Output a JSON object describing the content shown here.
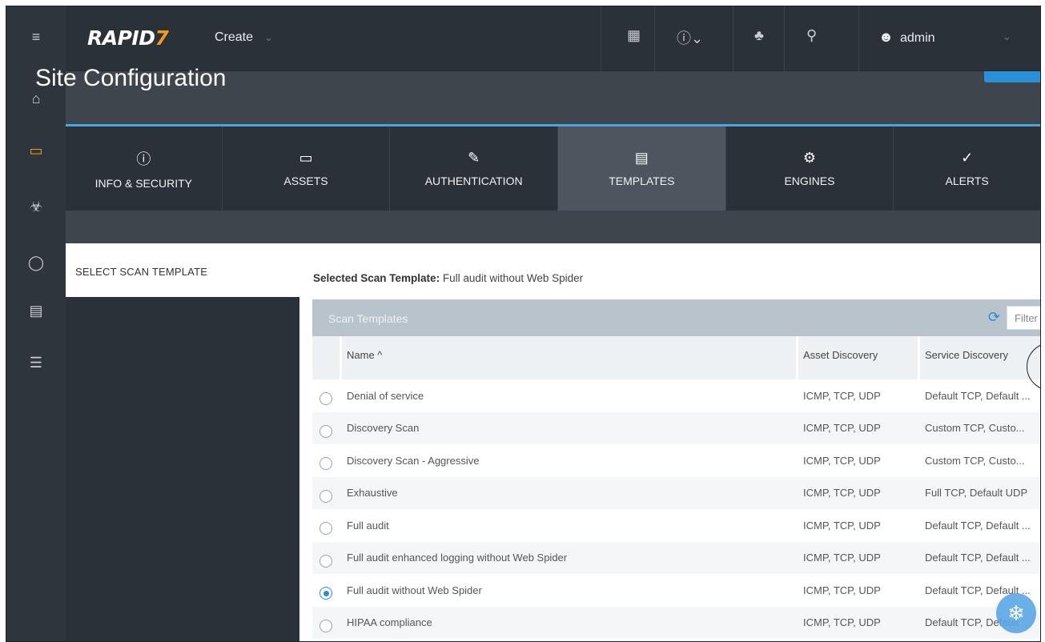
{
  "app": {
    "brand": "RAPID",
    "brand_mark": "7",
    "create_label": "Create"
  },
  "topbar": {
    "icons": [
      "calendar-icon",
      "help-icon",
      "bell-icon",
      "search-icon",
      "user-icon"
    ],
    "user_name": "admin"
  },
  "page": {
    "title": "Site Configuration"
  },
  "tabs": [
    {
      "label": "INFO & SECURITY",
      "icon": "info-icon",
      "active": false
    },
    {
      "label": "ASSETS",
      "icon": "monitor-icon",
      "active": false
    },
    {
      "label": "AUTHENTICATION",
      "icon": "credential-icon",
      "active": false
    },
    {
      "label": "TEMPLATES",
      "icon": "template-icon",
      "active": true
    },
    {
      "label": "ENGINES",
      "icon": "engine-gears-icon",
      "active": false
    },
    {
      "label": "ALERTS",
      "icon": "shield-check-icon",
      "active": false
    }
  ],
  "side_panel": {
    "label": "SELECT SCAN TEMPLATE"
  },
  "selected_template": {
    "prefix": "Selected Scan Template:",
    "value": "Full audit without Web Spider"
  },
  "grid": {
    "title": "Scan Templates",
    "filter_placeholder": "Filter",
    "columns": {
      "name": "Name ^",
      "asset": "Asset Discovery",
      "service": "Service Discovery"
    },
    "rows": [
      {
        "name": "Denial of service",
        "asset": "ICMP, TCP, UDP",
        "service": "Default TCP, Default ...",
        "selected": false
      },
      {
        "name": "Discovery Scan",
        "asset": "ICMP, TCP, UDP",
        "service": "Custom TCP, Custo...",
        "selected": false
      },
      {
        "name": "Discovery Scan - Aggressive",
        "asset": "ICMP, TCP, UDP",
        "service": "Custom TCP, Custo...",
        "selected": false
      },
      {
        "name": "Exhaustive",
        "asset": "ICMP, TCP, UDP",
        "service": "Full TCP, Default UDP",
        "selected": false
      },
      {
        "name": "Full audit",
        "asset": "ICMP, TCP, UDP",
        "service": "Default TCP, Default ...",
        "selected": false
      },
      {
        "name": "Full audit enhanced logging without Web Spider",
        "asset": "ICMP, TCP, UDP",
        "service": "Default TCP, Default ...",
        "selected": false
      },
      {
        "name": "Full audit without Web Spider",
        "asset": "ICMP, TCP, UDP",
        "service": "Default TCP, Default ...",
        "selected": true
      },
      {
        "name": "HIPAA compliance",
        "asset": "ICMP, TCP, UDP",
        "service": "Default TCP, Default ...",
        "selected": false
      }
    ]
  },
  "colors": {
    "accent_orange": "#f29a1f",
    "accent_blue": "#2b8fd6",
    "topbar_bg": "#2b3138"
  }
}
